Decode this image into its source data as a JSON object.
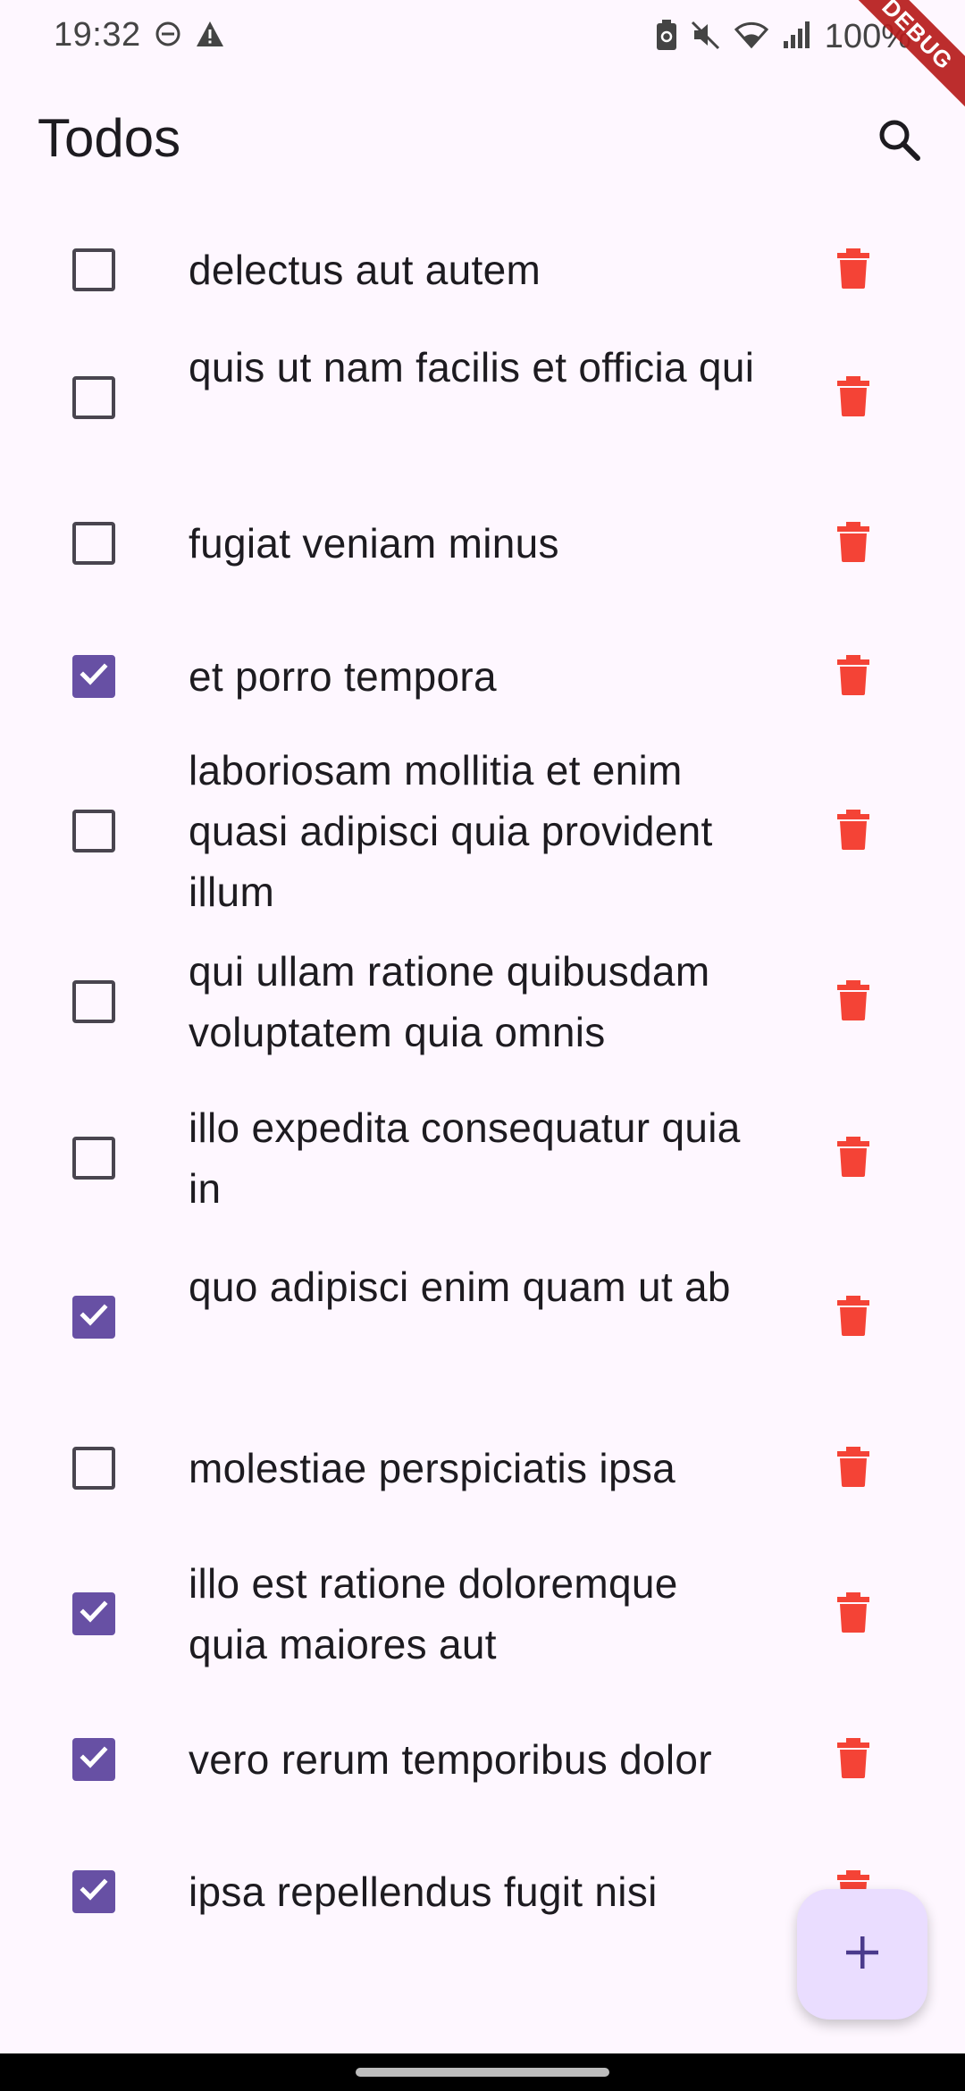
{
  "status_bar": {
    "time": "19:32",
    "left_icons": [
      "dnd-icon",
      "warning-icon"
    ],
    "right_icons": [
      "battery-saver-icon",
      "mute-icon",
      "wifi-icon",
      "signal-icon"
    ],
    "battery": "100%"
  },
  "debug_banner": "DEBUG",
  "app_bar": {
    "title": "Todos",
    "search_icon": "search-icon"
  },
  "colors": {
    "background": "#FEF7FF",
    "accent": "#6750A4",
    "delete": "#F44336",
    "fab": "#EADDFF"
  },
  "todos": [
    {
      "text": "delectus aut autem",
      "checked": false
    },
    {
      "text": "quis ut nam facilis et officia qui",
      "checked": false
    },
    {
      "text": "fugiat veniam minus",
      "checked": false
    },
    {
      "text": "et porro tempora",
      "checked": true
    },
    {
      "text": "laboriosam mollitia et enim quasi adipisci quia provident illum",
      "checked": false
    },
    {
      "text": "qui ullam ratione quibusdam voluptatem quia omnis",
      "checked": false
    },
    {
      "text": "illo expedita consequatur quia in",
      "checked": false
    },
    {
      "text": "quo adipisci enim quam ut ab",
      "checked": true
    },
    {
      "text": "molestiae perspiciatis ipsa",
      "checked": false
    },
    {
      "text": "illo est ratione doloremque quia maiores aut",
      "checked": true
    },
    {
      "text": "vero rerum temporibus dolor",
      "checked": true
    },
    {
      "text": "ipsa repellendus fugit nisi",
      "checked": true
    }
  ],
  "fab": {
    "icon": "plus-icon"
  }
}
